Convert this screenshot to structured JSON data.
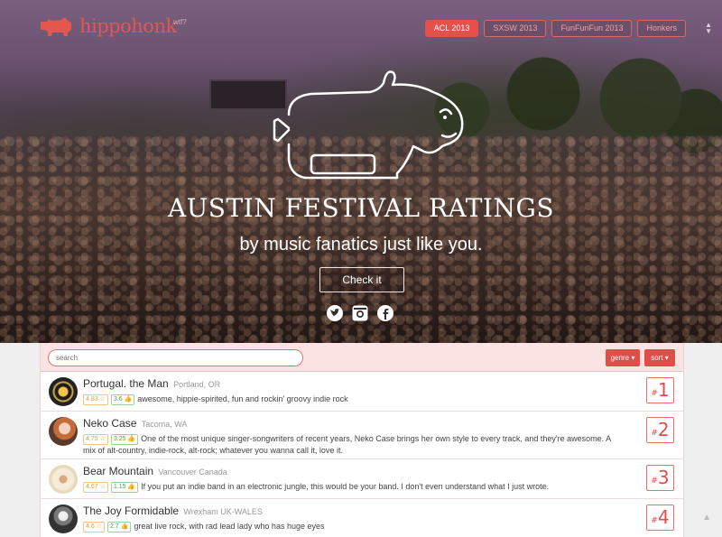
{
  "brand": {
    "name": "hippohonk",
    "tag": "wtf?"
  },
  "nav": [
    {
      "label": "ACL 2013",
      "active": true
    },
    {
      "label": "SXSW 2013",
      "active": false
    },
    {
      "label": "FunFunFun 2013",
      "active": false
    },
    {
      "label": "Honkers",
      "active": false
    }
  ],
  "hero": {
    "title": "AUSTIN FESTIVAL RATINGS",
    "subtitle": "by music fanatics just like you.",
    "cta": "Check it",
    "social_icons": [
      "twitter-icon",
      "instagram-icon",
      "facebook-icon"
    ]
  },
  "toolbar": {
    "search_placeholder": "search",
    "genre_label": "genre ▾",
    "sort_label": "sort ▾"
  },
  "bands": [
    {
      "name": "Portugal. the Man",
      "location": "Portland, OR",
      "rating": "4.83 ☆",
      "votes": "3.6 👍",
      "desc": "awesome, hippie-spirited, fun and rockin' groovy indie rock",
      "rank": "1"
    },
    {
      "name": "Neko Case",
      "location": "Tacoma, WA",
      "rating": "4.75 ☆",
      "votes": "3.25 👍",
      "desc": "One of the most unique singer-songwriters of recent years, Neko Case brings her own style to every track, and they're awesome. A mix of alt-country, indie-rock, alt-rock; whatever you wanna call it, love it.",
      "rank": "2"
    },
    {
      "name": "Bear Mountain",
      "location": "Vancouver Canada",
      "rating": "4.67 ☆",
      "votes": "1.15 👍",
      "desc": "If you put an indie band in an electronic jungle, this would be your band. I don't even understand what I just wrote.",
      "rank": "3"
    },
    {
      "name": "The Joy Formidable",
      "location": "Wrexham UK-WALES",
      "rating": "4.6 ☆",
      "votes": "2.7 👍",
      "desc": "great live rock, with rad lead lady who has huge eyes",
      "rank": "4"
    }
  ],
  "colors": {
    "accent": "#e14d48",
    "rating": "#e89a2b",
    "votes": "#4da04a"
  }
}
